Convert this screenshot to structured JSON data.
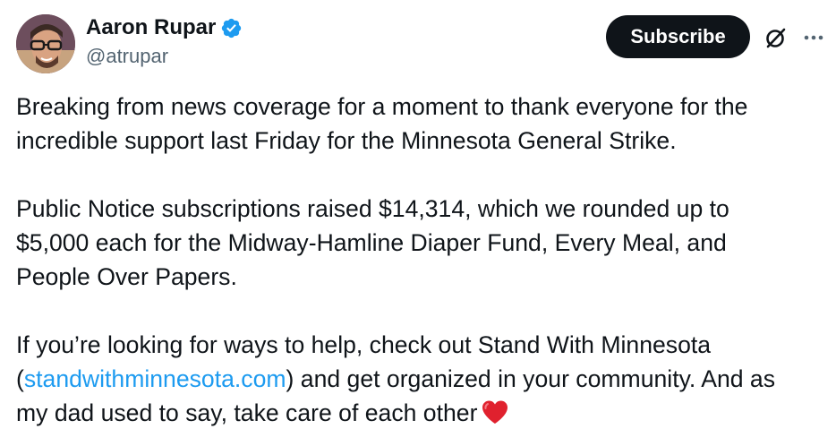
{
  "author": {
    "display_name": "Aaron Rupar",
    "handle": "@atrupar",
    "verified_color": "#1d9bf0",
    "avatar_icon": "avatar-photo"
  },
  "actions": {
    "subscribe_label": "Subscribe",
    "grok_icon": "grok-icon",
    "more_icon": "more-icon"
  },
  "tweet": {
    "p1": "Breaking from news coverage for a moment to thank everyone for the incredible support last Friday for the Minnesota General Strike.",
    "p2_line1": "Public Notice subscriptions raised $14,314, which we rounded up to",
    "p2_line2": "$5,000 each for the Midway-Hamline Diaper Fund, Every Meal, and",
    "p2_line3": "People Over Papers.",
    "p3_line1": "If you’re looking for ways to help, check out Stand With Minnesota",
    "p3_open_paren": "(",
    "p3_link": "standwithminnesota.com",
    "p3_after_link": ") and get organized in your community. And as",
    "p3_line3": "my dad used to say, take care of each other",
    "emoji": "red-heart",
    "link_color": "#1d9bf0"
  }
}
